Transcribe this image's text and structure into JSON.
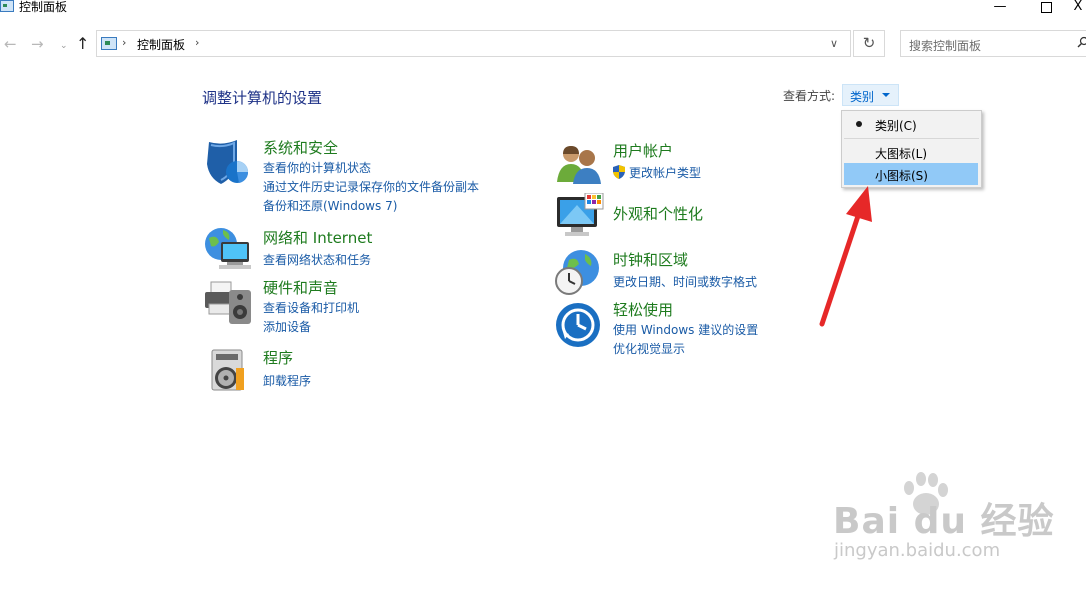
{
  "window": {
    "title": "控制面板",
    "min_label": "—",
    "close_label": "X"
  },
  "nav": {
    "back": "←",
    "forward": "→",
    "recent": "⌄",
    "up": "↑",
    "refresh": "↻",
    "dropdown": "∨",
    "separator": "›"
  },
  "breadcrumb": [
    "控制面板"
  ],
  "search": {
    "placeholder": "搜索控制面板"
  },
  "main": {
    "title": "调整计算机的设置"
  },
  "view_by": {
    "label": "查看方式:",
    "value": "类别",
    "options": [
      "类别(C)",
      "大图标(L)",
      "小图标(S)"
    ],
    "selected_index": 0,
    "highlighted_index": 2
  },
  "categories_left": [
    {
      "title": "系统和安全",
      "links": [
        "查看你的计算机状态",
        "通过文件历史记录保存你的文件备份副本",
        "备份和还原(Windows 7)"
      ],
      "icon": "shield-icon"
    },
    {
      "title": "网络和 Internet",
      "links": [
        "查看网络状态和任务"
      ],
      "icon": "network-globe-icon"
    },
    {
      "title": "硬件和声音",
      "links": [
        "查看设备和打印机",
        "添加设备"
      ],
      "icon": "printer-speaker-icon"
    },
    {
      "title": "程序",
      "links": [
        "卸载程序"
      ],
      "icon": "programs-disc-icon"
    }
  ],
  "categories_right": [
    {
      "title": "用户帐户",
      "links": [
        "更改帐户类型"
      ],
      "icon": "users-icon",
      "link_icon": "uac-shield-icon"
    },
    {
      "title": "外观和个性化",
      "links": [],
      "icon": "monitor-palette-icon"
    },
    {
      "title": "时钟和区域",
      "links": [
        "更改日期、时间或数字格式"
      ],
      "icon": "clock-globe-icon"
    },
    {
      "title": "轻松使用",
      "links": [
        "使用 Windows 建议的设置",
        "优化视觉显示"
      ],
      "icon": "ease-of-access-icon"
    }
  ],
  "watermark": {
    "logo": "Bai du 经验",
    "url": "jingyan.baidu.com"
  },
  "colors": {
    "category_title": "#1e7b1e",
    "link": "#1a5ba6",
    "menu_highlight": "#91c9f7",
    "annotation_arrow": "#e62828"
  }
}
